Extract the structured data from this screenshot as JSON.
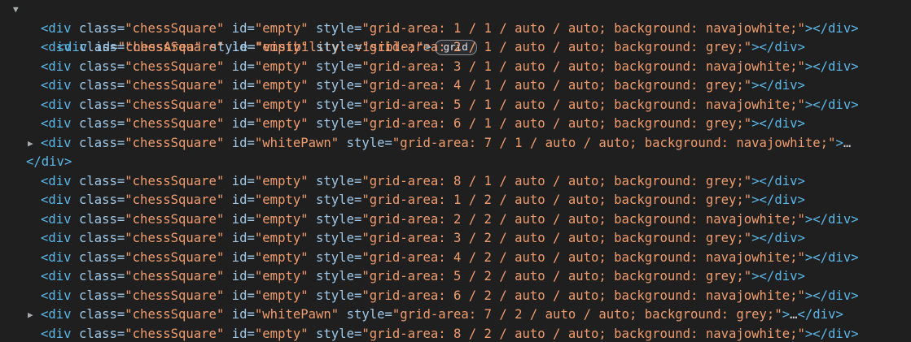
{
  "parent": {
    "open_tag": "<div",
    "id_attr": " id=",
    "id_val": "\"chessArea\"",
    "style_attr": " style=",
    "style_val": "\"visibility: visible;\"",
    "tag_end": ">",
    "badge": "grid"
  },
  "rows": [
    {
      "expand": false,
      "id": "\"empty\"",
      "style": "\"grid-area: 1 / 1 / auto / auto; background: navajowhite;\"",
      "tail": "></div>"
    },
    {
      "expand": false,
      "id": "\"empty\"",
      "style": "\"grid-area: 2 / 1 / auto / auto; background: grey;\"",
      "tail": "></div>"
    },
    {
      "expand": false,
      "id": "\"empty\"",
      "style": "\"grid-area: 3 / 1 / auto / auto; background: navajowhite;\"",
      "tail": "></div>"
    },
    {
      "expand": false,
      "id": "\"empty\"",
      "style": "\"grid-area: 4 / 1 / auto / auto; background: grey;\"",
      "tail": "></div>"
    },
    {
      "expand": false,
      "id": "\"empty\"",
      "style": "\"grid-area: 5 / 1 / auto / auto; background: navajowhite;\"",
      "tail": "></div>"
    },
    {
      "expand": false,
      "id": "\"empty\"",
      "style": "\"grid-area: 6 / 1 / auto / auto; background: grey;\"",
      "tail": "></div>"
    },
    {
      "expand": true,
      "id": "\"whitePawn\"",
      "style": "\"grid-area: 7 / 1 / auto / auto; background: navajowhite;\"",
      "tail": ">…"
    },
    {
      "closing": true,
      "text": "</div>"
    },
    {
      "expand": false,
      "id": "\"empty\"",
      "style": "\"grid-area: 8 / 1 / auto / auto; background: grey;\"",
      "tail": "></div>"
    },
    {
      "expand": false,
      "id": "\"empty\"",
      "style": "\"grid-area: 1 / 2 / auto / auto; background: grey;\"",
      "tail": "></div>"
    },
    {
      "expand": false,
      "id": "\"empty\"",
      "style": "\"grid-area: 2 / 2 / auto / auto; background: navajowhite;\"",
      "tail": "></div>"
    },
    {
      "expand": false,
      "id": "\"empty\"",
      "style": "\"grid-area: 3 / 2 / auto / auto; background: grey;\"",
      "tail": "></div>"
    },
    {
      "expand": false,
      "id": "\"empty\"",
      "style": "\"grid-area: 4 / 2 / auto / auto; background: navajowhite;\"",
      "tail": "></div>"
    },
    {
      "expand": false,
      "id": "\"empty\"",
      "style": "\"grid-area: 5 / 2 / auto / auto; background: grey;\"",
      "tail": "></div>"
    },
    {
      "expand": false,
      "id": "\"empty\"",
      "style": "\"grid-area: 6 / 2 / auto / auto; background: navajowhite;\"",
      "tail": "></div>"
    },
    {
      "expand": true,
      "id": "\"whitePawn\"",
      "style": "\"grid-area: 7 / 2 / auto / auto; background: grey;\"",
      "tail": ">…</div>"
    },
    {
      "expand": false,
      "id": "\"empty\"",
      "style": "\"grid-area: 8 / 2 / auto / auto; background: navajowhite;\"",
      "tail": "></div>"
    }
  ],
  "child_parts": {
    "open_tag": "<div",
    "class_attr": " class=",
    "class_val": "\"chessSquare\"",
    "id_attr": " id=",
    "style_attr": " style="
  }
}
